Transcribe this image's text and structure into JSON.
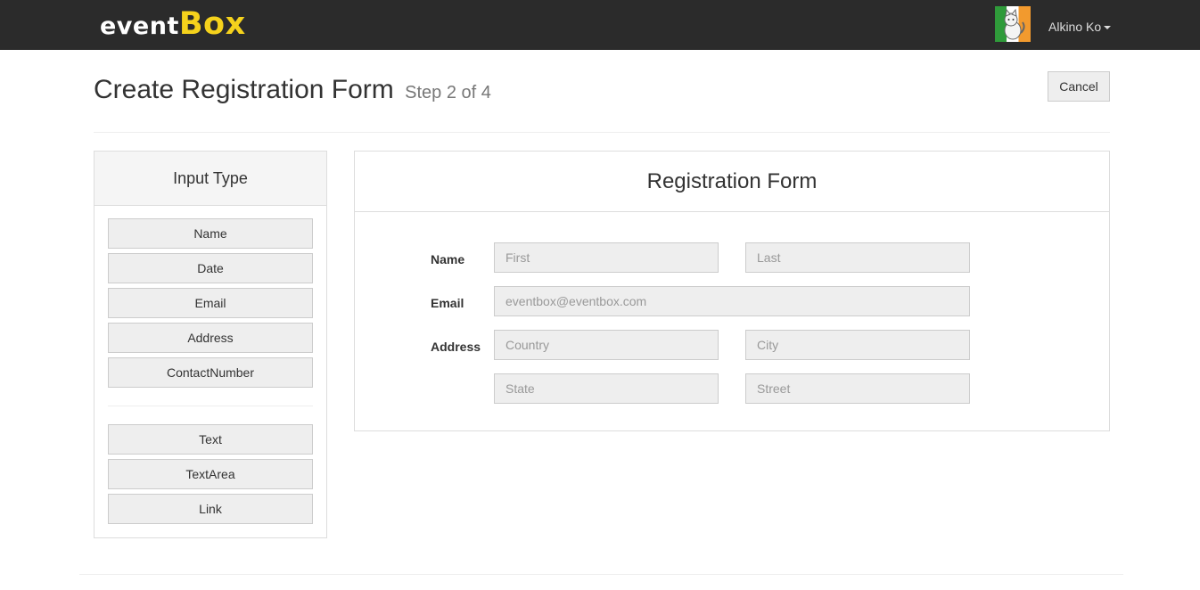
{
  "navbar": {
    "logo_part1": "event",
    "logo_part2": "Box",
    "user_name": "Alkino Ko",
    "colors": {
      "background": "#2b2b2b",
      "logo_accent": "#f5d21c"
    }
  },
  "header": {
    "title": "Create Registration Form",
    "step": "Step 2 of 4",
    "cancel_label": "Cancel"
  },
  "input_type_panel": {
    "title": "Input Type",
    "group1": [
      "Name",
      "Date",
      "Email",
      "Address",
      "ContactNumber"
    ],
    "group2": [
      "Text",
      "TextArea",
      "Link"
    ]
  },
  "registration_form": {
    "title": "Registration Form",
    "name": {
      "label": "Name",
      "first_placeholder": "First",
      "last_placeholder": "Last"
    },
    "email": {
      "label": "Email",
      "placeholder": "eventbox@eventbox.com"
    },
    "address": {
      "label": "Address",
      "country_placeholder": "Country",
      "city_placeholder": "City",
      "state_placeholder": "State",
      "street_placeholder": "Street"
    }
  }
}
